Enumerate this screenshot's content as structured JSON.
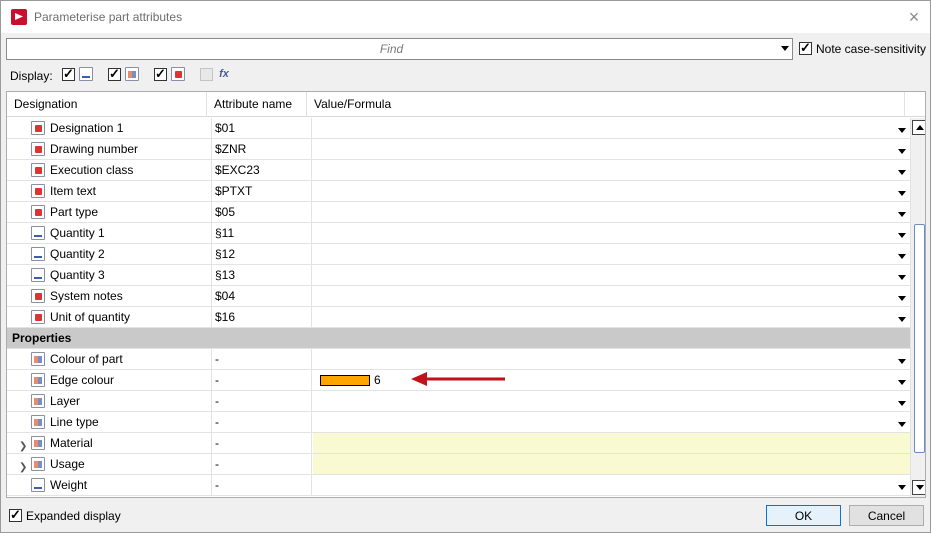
{
  "window": {
    "title": "Parameterise part attributes",
    "close_label": "×"
  },
  "search": {
    "placeholder": "Find",
    "value": "",
    "case_sensitivity_label": "Note case-sensitivity",
    "case_sensitivity_checked": true
  },
  "display": {
    "label": "Display:",
    "filters": [
      {
        "icon": "numeric-attribute-icon",
        "checked": true
      },
      {
        "icon": "mixed-attribute-icon",
        "checked": true
      },
      {
        "icon": "text-attribute-icon",
        "checked": true
      },
      {
        "icon": "formula-fx-icon",
        "checked": false,
        "enabled": false
      }
    ]
  },
  "table": {
    "columns": [
      "Designation",
      "Attribute name",
      "Value/Formula"
    ],
    "rows_top": [
      {
        "designation": "Designation 1",
        "attribute": "$01",
        "icon": "text-attribute-icon"
      },
      {
        "designation": "Drawing number",
        "attribute": "$ZNR",
        "icon": "text-attribute-icon"
      },
      {
        "designation": "Execution class",
        "attribute": "$EXC23",
        "icon": "text-attribute-icon"
      },
      {
        "designation": "Item text",
        "attribute": "$PTXT",
        "icon": "text-attribute-icon"
      },
      {
        "designation": "Part type",
        "attribute": "$05",
        "icon": "text-attribute-icon"
      },
      {
        "designation": "Quantity 1",
        "attribute": "§11",
        "icon": "numeric-attribute-icon"
      },
      {
        "designation": "Quantity 2",
        "attribute": "§12",
        "icon": "numeric-attribute-icon"
      },
      {
        "designation": "Quantity 3",
        "attribute": "§13",
        "icon": "numeric-attribute-icon"
      },
      {
        "designation": "System notes",
        "attribute": "$04",
        "icon": "text-attribute-icon"
      },
      {
        "designation": "Unit of quantity",
        "attribute": "$16",
        "icon": "text-attribute-icon"
      }
    ],
    "group_label": "Properties",
    "rows_props": [
      {
        "designation": "Colour of part",
        "attribute": "-",
        "icon": "mixed-attribute-icon"
      },
      {
        "designation": "Edge colour",
        "attribute": "-",
        "icon": "mixed-attribute-icon",
        "value": "6",
        "swatch_color": "#FFA500"
      },
      {
        "designation": "Layer",
        "attribute": "-",
        "icon": "mixed-attribute-icon"
      },
      {
        "designation": "Line type",
        "attribute": "-",
        "icon": "mixed-attribute-icon"
      },
      {
        "designation": "Material",
        "attribute": "-",
        "icon": "mixed-attribute-icon",
        "expandable": true
      },
      {
        "designation": "Usage",
        "attribute": "-",
        "icon": "mixed-attribute-icon",
        "expandable": true
      },
      {
        "designation": "Weight",
        "attribute": "-",
        "icon": "numeric-attribute-icon"
      }
    ]
  },
  "footer": {
    "expanded_display_label": "Expanded display",
    "expanded_display_checked": true,
    "ok_label": "OK",
    "cancel_label": "Cancel"
  },
  "colors": {
    "accent": "#0078D7",
    "group_header_bg": "#C9C9C9",
    "readonly_value_bg": "#FAFAD2",
    "annotation_arrow": "#C0121B"
  }
}
